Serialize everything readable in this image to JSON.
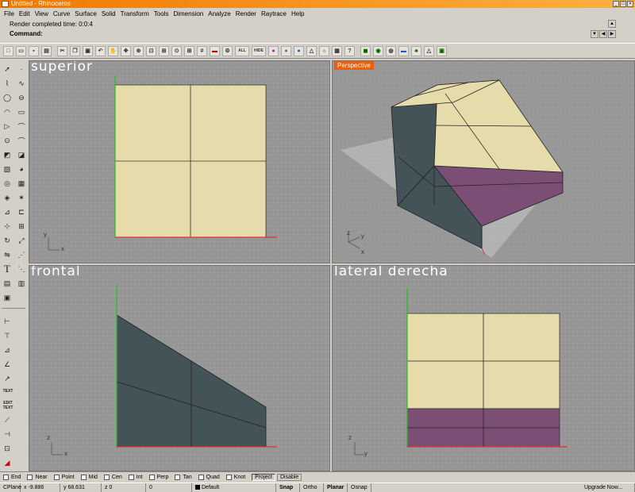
{
  "window": {
    "title": "Untitled - Rhinoceros"
  },
  "menu": [
    "File",
    "Edit",
    "View",
    "Curve",
    "Surface",
    "Solid",
    "Transform",
    "Tools",
    "Dimension",
    "Analyze",
    "Render",
    "Raytrace",
    "Help"
  ],
  "command": {
    "history": "Render completed time: 0:0:4",
    "prompt": "Command:"
  },
  "toolbar_icons": [
    "new-icon",
    "open-icon",
    "save-icon",
    "print-icon",
    "cut-icon",
    "copy-icon",
    "paste-icon",
    "undo-icon",
    "pan-icon",
    "rotate-view-icon",
    "zoom-dynamic-icon",
    "zoom-window-icon",
    "zoom-extents-icon",
    "zoom-selected-icon",
    "four-views-icon",
    "grid-icon",
    "car-render-icon",
    "gear-icon",
    "select-all-icon",
    "hide-icon",
    "color-wheel-icon",
    "sphere-icon",
    "blue-sphere-icon",
    "cone-icon",
    "lights-icon",
    "text-icon",
    "help-icon",
    "render-icon",
    "raytrace-icon",
    "environment-icon",
    "ground-plane-icon",
    "tree-icon",
    "light-icon",
    "preview-icon"
  ],
  "toolbar_text": {
    "all": "ALL",
    "hide": "HIDE"
  },
  "left_tools": {
    "text_label": "TEXT",
    "edit_text_label": "EDIT TEXT",
    "text_tool": "T"
  },
  "viewports": {
    "top": {
      "label": "superior"
    },
    "perspective": {
      "label": "Perspective"
    },
    "front": {
      "label": "frontal"
    },
    "right": {
      "label": "lateral derecha"
    }
  },
  "axes": {
    "x": "x",
    "y": "y",
    "z": "z"
  },
  "osnap": {
    "items": [
      "End",
      "Near",
      "Point",
      "Mid",
      "Cen",
      "Int",
      "Perp",
      "Tan",
      "Quad",
      "Knot"
    ],
    "buttons": [
      "Project",
      "Disable"
    ]
  },
  "status": {
    "cplane": "CPlane",
    "x": "x -9.886",
    "y": "y 68.631",
    "z": "z 0",
    "extra": "0",
    "layer": "Default",
    "snap": "Snap",
    "ortho": "Ortho",
    "planar": "Planar",
    "osnap": "Osnap",
    "upgrade": "Upgrade Now..."
  },
  "colors": {
    "accent": "#e86010",
    "surface": "#e6dbaa",
    "dark_face": "#435358",
    "purple_face": "#7b4f75",
    "axis_red": "#e03030",
    "axis_green": "#20c020"
  }
}
